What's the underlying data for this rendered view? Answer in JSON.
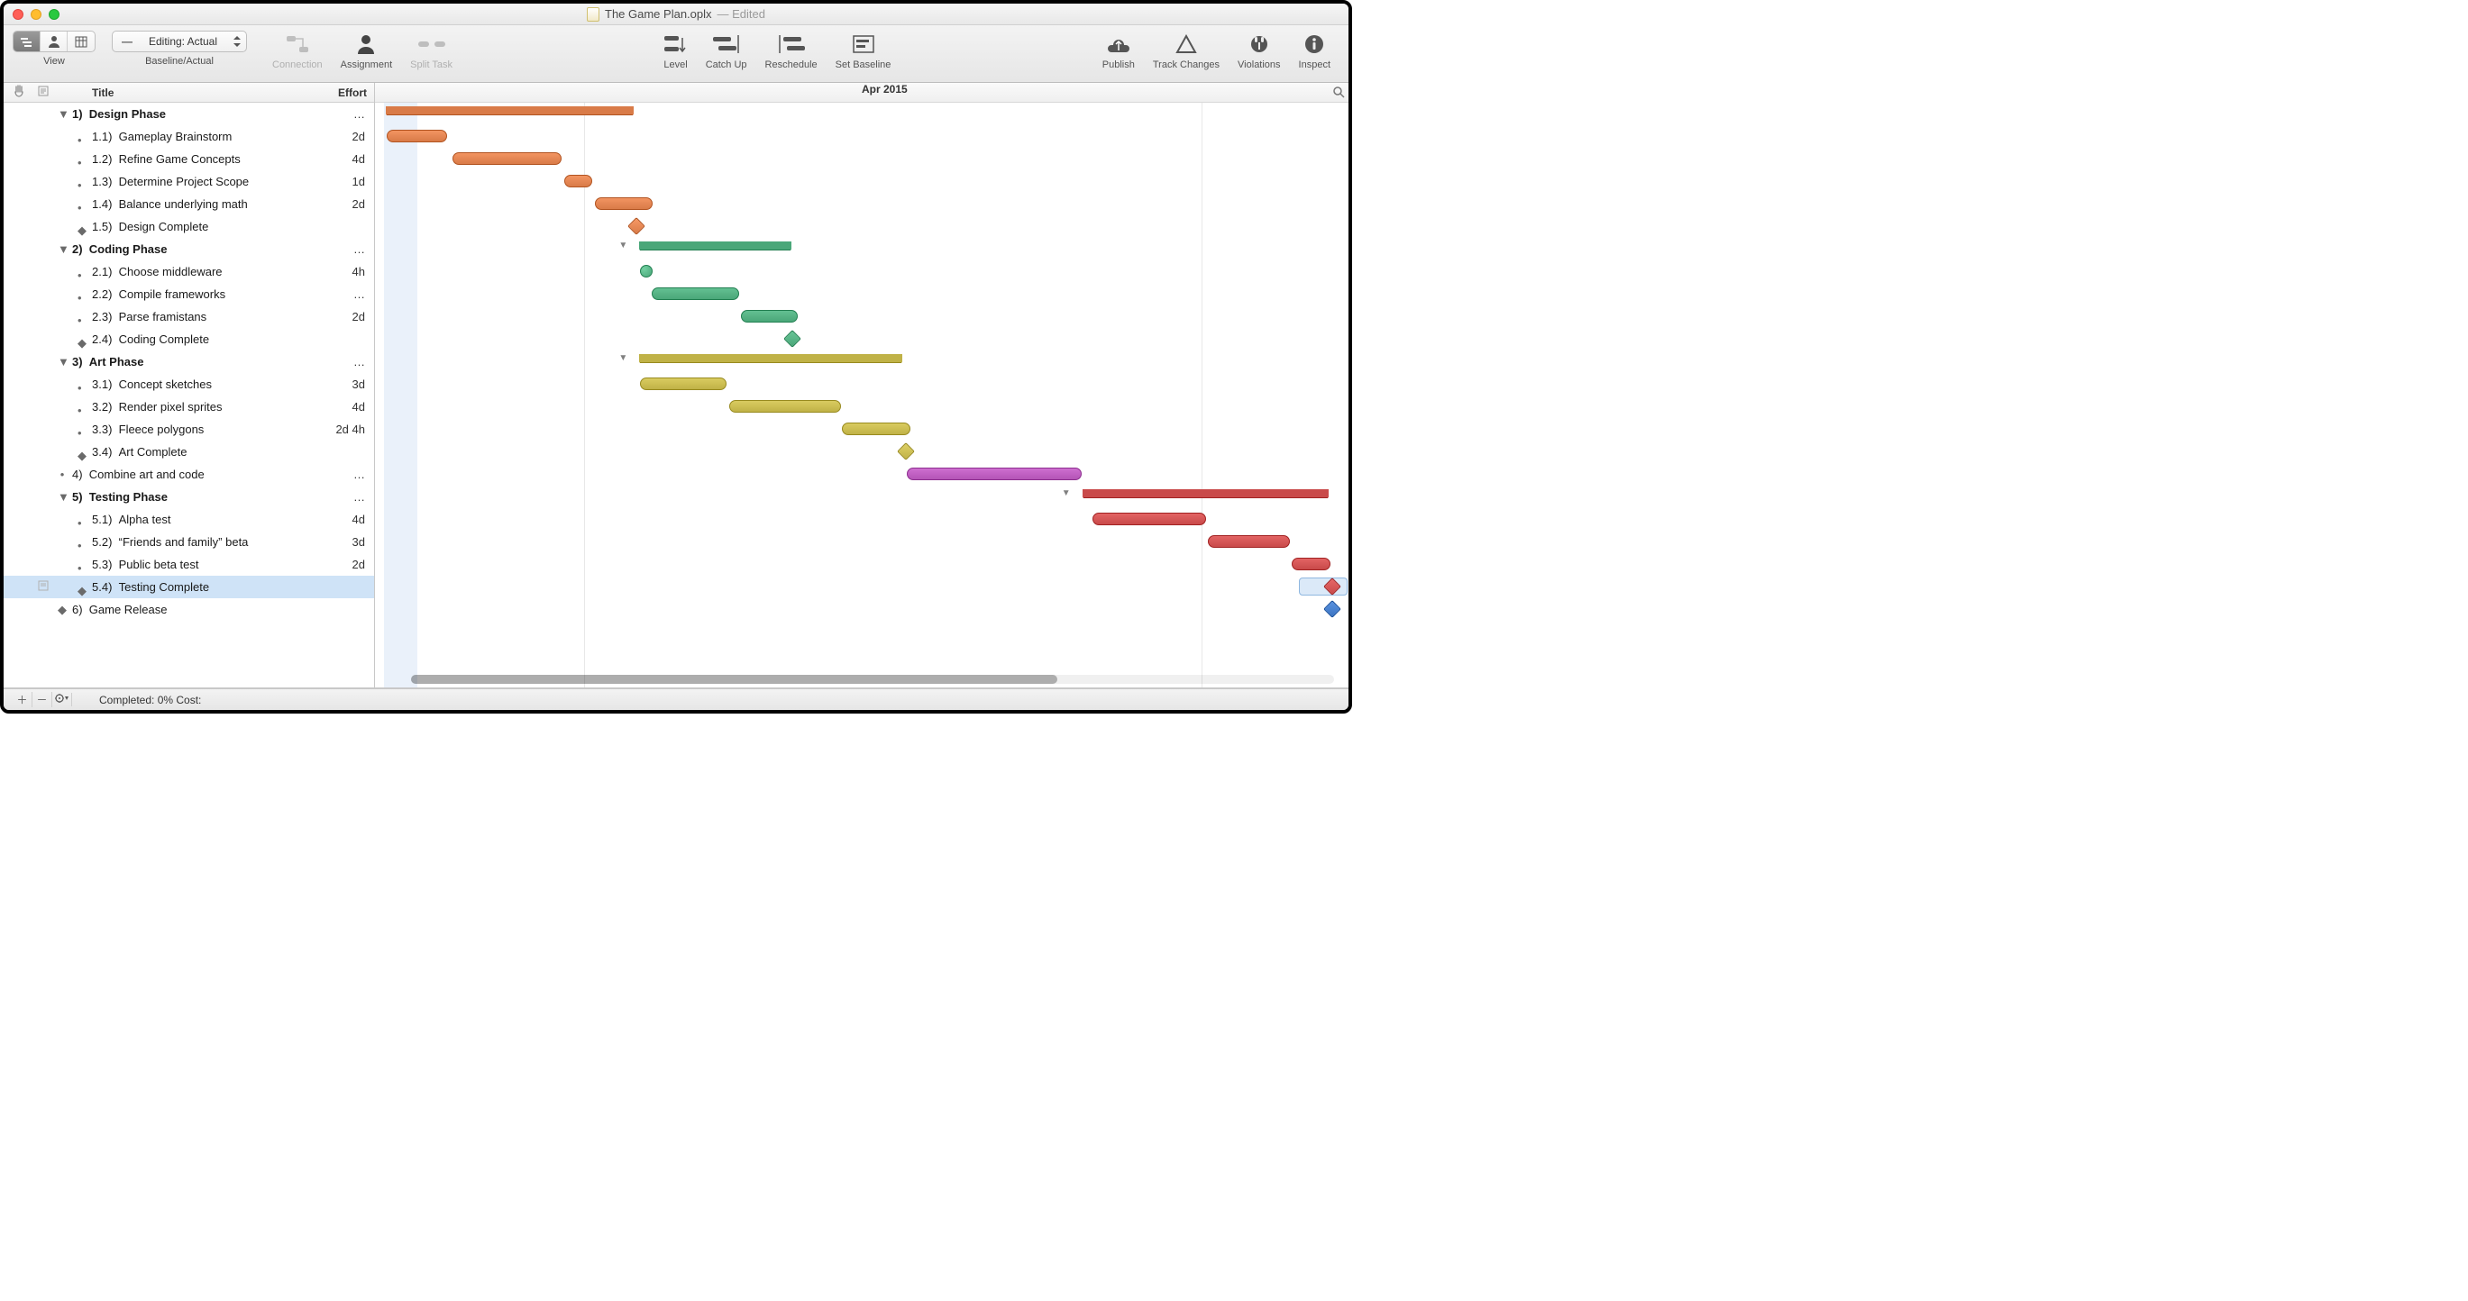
{
  "window": {
    "doc_title": "The Game Plan.oplx",
    "edited_suffix": "— Edited"
  },
  "toolbar": {
    "view_label": "View",
    "baseline_actual_label": "Baseline/Actual",
    "baseline_dropdown_icon": "—",
    "baseline_dropdown": "Editing: Actual",
    "connection": "Connection",
    "assignment": "Assignment",
    "split_task": "Split Task",
    "level": "Level",
    "catch_up": "Catch Up",
    "reschedule": "Reschedule",
    "set_baseline": "Set Baseline",
    "publish": "Publish",
    "track_changes": "Track Changes",
    "violations": "Violations",
    "inspect": "Inspect"
  },
  "outline": {
    "columns": {
      "title": "Title",
      "effort": "Effort"
    },
    "rows": [
      {
        "id": "1",
        "level": 1,
        "group": true,
        "num": "1)",
        "title": "Design Phase",
        "effort": "…"
      },
      {
        "id": "1.1",
        "level": 2,
        "group": false,
        "num": "1.1)",
        "title": "Gameplay Brainstorm",
        "effort": "2d"
      },
      {
        "id": "1.2",
        "level": 2,
        "group": false,
        "num": "1.2)",
        "title": "Refine Game Concepts",
        "effort": "4d"
      },
      {
        "id": "1.3",
        "level": 2,
        "group": false,
        "num": "1.3)",
        "title": "Determine Project Scope",
        "effort": "1d"
      },
      {
        "id": "1.4",
        "level": 2,
        "group": false,
        "num": "1.4)",
        "title": "Balance underlying math",
        "effort": "2d"
      },
      {
        "id": "1.5",
        "level": 2,
        "milestone": true,
        "num": "1.5)",
        "title": "Design Complete",
        "effort": ""
      },
      {
        "id": "2",
        "level": 1,
        "group": true,
        "num": "2)",
        "title": "Coding Phase",
        "effort": "…"
      },
      {
        "id": "2.1",
        "level": 2,
        "group": false,
        "num": "2.1)",
        "title": "Choose middleware",
        "effort": "4h"
      },
      {
        "id": "2.2",
        "level": 2,
        "group": false,
        "num": "2.2)",
        "title": "Compile frameworks",
        "effort": "…"
      },
      {
        "id": "2.3",
        "level": 2,
        "group": false,
        "num": "2.3)",
        "title": "Parse framistans",
        "effort": "2d"
      },
      {
        "id": "2.4",
        "level": 2,
        "milestone": true,
        "num": "2.4)",
        "title": "Coding Complete",
        "effort": ""
      },
      {
        "id": "3",
        "level": 1,
        "group": true,
        "num": "3)",
        "title": "Art Phase",
        "effort": "…"
      },
      {
        "id": "3.1",
        "level": 2,
        "group": false,
        "num": "3.1)",
        "title": "Concept sketches",
        "effort": "3d"
      },
      {
        "id": "3.2",
        "level": 2,
        "group": false,
        "num": "3.2)",
        "title": "Render pixel sprites",
        "effort": "4d"
      },
      {
        "id": "3.3",
        "level": 2,
        "group": false,
        "num": "3.3)",
        "title": "Fleece polygons",
        "effort": "2d 4h"
      },
      {
        "id": "3.4",
        "level": 2,
        "milestone": true,
        "num": "3.4)",
        "title": "Art Complete",
        "effort": ""
      },
      {
        "id": "4",
        "level": 1,
        "group": false,
        "num": "4)",
        "title": "Combine art and code",
        "effort": "…",
        "bullet": true
      },
      {
        "id": "5",
        "level": 1,
        "group": true,
        "num": "5)",
        "title": "Testing Phase",
        "effort": "…"
      },
      {
        "id": "5.1",
        "level": 2,
        "group": false,
        "num": "5.1)",
        "title": "Alpha test",
        "effort": "4d"
      },
      {
        "id": "5.2",
        "level": 2,
        "group": false,
        "num": "5.2)",
        "title": "“Friends and family” beta",
        "effort": "3d"
      },
      {
        "id": "5.3",
        "level": 2,
        "group": false,
        "num": "5.3)",
        "title": "Public beta test",
        "effort": "2d"
      },
      {
        "id": "5.4",
        "level": 2,
        "milestone": true,
        "num": "5.4)",
        "title": "Testing Complete",
        "effort": "",
        "selected": true,
        "note": true
      },
      {
        "id": "6",
        "level": 1,
        "milestone": true,
        "num": "6)",
        "title": "Game Release",
        "effort": ""
      }
    ]
  },
  "timeline": {
    "month_label": "Apr 2015"
  },
  "chart_data": {
    "type": "gantt",
    "time_unit": "day index (0 = chart start)",
    "colors": {
      "design": "#d97b48",
      "coding": "#4aa779",
      "art": "#c0b247",
      "combine": "#b455b6",
      "testing": "#c94a4a",
      "release": "#3b74c2"
    },
    "tasks": [
      {
        "id": "1",
        "type": "summary",
        "start": 0.1,
        "end": 9.8,
        "colorKey": "design",
        "row": 0
      },
      {
        "id": "1.1",
        "type": "task",
        "start": 0.1,
        "end": 2.5,
        "colorKey": "design",
        "row": 1
      },
      {
        "id": "1.2",
        "type": "task",
        "start": 2.7,
        "end": 7.0,
        "colorKey": "design",
        "row": 2
      },
      {
        "id": "1.3",
        "type": "task",
        "start": 7.1,
        "end": 8.2,
        "colorKey": "design",
        "row": 3
      },
      {
        "id": "1.4",
        "type": "task",
        "start": 8.3,
        "end": 10.6,
        "colorKey": "design",
        "row": 4
      },
      {
        "id": "1.5",
        "type": "milestone",
        "at": 9.95,
        "colorKey": "design",
        "row": 5
      },
      {
        "id": "2",
        "type": "summary",
        "start": 10.1,
        "end": 16.0,
        "colorKey": "coding",
        "row": 6,
        "disclosure": true
      },
      {
        "id": "2.1",
        "type": "dot",
        "at": 10.35,
        "colorKey": "coding",
        "row": 7
      },
      {
        "id": "2.2",
        "type": "task",
        "start": 10.55,
        "end": 14.0,
        "colorKey": "coding",
        "row": 8
      },
      {
        "id": "2.3",
        "type": "task",
        "start": 14.05,
        "end": 16.3,
        "colorKey": "coding",
        "row": 9
      },
      {
        "id": "2.4",
        "type": "milestone",
        "at": 16.1,
        "colorKey": "coding",
        "row": 10
      },
      {
        "id": "3",
        "type": "summary",
        "start": 10.1,
        "end": 20.4,
        "colorKey": "art",
        "row": 11,
        "disclosure": true
      },
      {
        "id": "3.1",
        "type": "task",
        "start": 10.1,
        "end": 13.5,
        "colorKey": "art",
        "row": 12
      },
      {
        "id": "3.2",
        "type": "task",
        "start": 13.6,
        "end": 18.0,
        "colorKey": "art",
        "row": 13
      },
      {
        "id": "3.3",
        "type": "task",
        "start": 18.05,
        "end": 20.75,
        "colorKey": "art",
        "row": 14
      },
      {
        "id": "3.4",
        "type": "milestone",
        "at": 20.55,
        "colorKey": "art",
        "row": 15
      },
      {
        "id": "4",
        "type": "task",
        "start": 20.6,
        "end": 27.5,
        "colorKey": "combine",
        "row": 16
      },
      {
        "id": "5",
        "type": "summary",
        "start": 27.55,
        "end": 37.2,
        "colorKey": "testing",
        "row": 17,
        "disclosure": true
      },
      {
        "id": "5.1",
        "type": "task",
        "start": 27.9,
        "end": 32.4,
        "colorKey": "testing",
        "row": 18
      },
      {
        "id": "5.2",
        "type": "task",
        "start": 32.45,
        "end": 35.7,
        "colorKey": "testing",
        "row": 19
      },
      {
        "id": "5.3",
        "type": "task",
        "start": 35.75,
        "end": 37.3,
        "colorKey": "testing",
        "row": 20
      },
      {
        "id": "5.4",
        "type": "milestone",
        "at": 37.35,
        "colorKey": "testing",
        "row": 21,
        "highlight": true
      },
      {
        "id": "6",
        "type": "milestone",
        "at": 37.35,
        "colorKey": "release",
        "row": 22
      }
    ],
    "today_band": {
      "start": 0,
      "end": 1.3
    },
    "visible_range_days": 38
  },
  "footer": {
    "status": "Completed: 0% Cost:"
  }
}
